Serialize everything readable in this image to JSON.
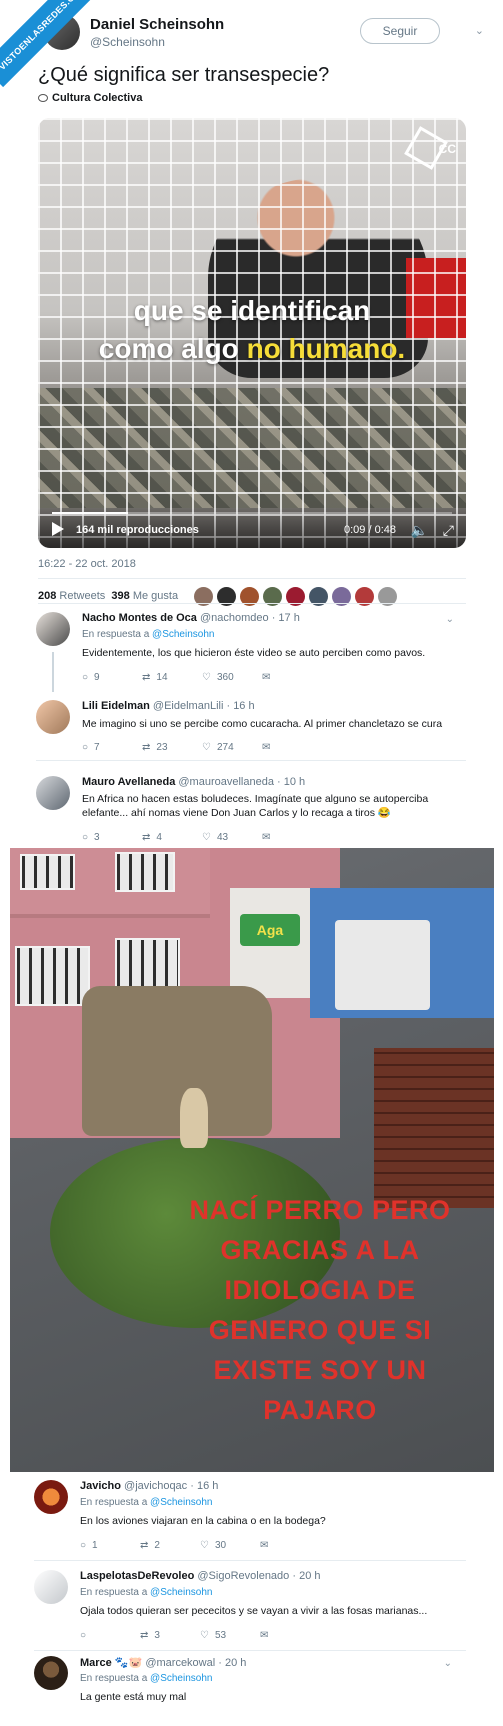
{
  "watermark": "VISTOENLASREDES.COM",
  "tweet": {
    "author_name": "Daniel Scheinsohn",
    "author_handle": "@Scheinsohn",
    "follow_label": "Seguir",
    "text": "¿Qué significa ser transespecie?",
    "source": "Cultura Colectiva",
    "video": {
      "caption_line1": "que se identifican",
      "caption_line2_plain": "como algo",
      "caption_line2_highlight": "no humano.",
      "brand": "CC",
      "views": "164 mil reproducciones",
      "timecode": "0:09 / 0:48",
      "progress_fraction": 0.19
    },
    "timestamp": "16:22 - 22 oct. 2018",
    "retweets_count": "208",
    "retweets_label": "Retweets",
    "likes_count": "398",
    "likes_label": "Me gusta"
  },
  "replies_top": [
    {
      "name": "Nacho Montes de Oca",
      "handle": "@nachomdeo",
      "time": "· 17 h",
      "in_reply_prefix": "En respuesta a",
      "in_reply_to": "@Scheinsohn",
      "text": "Evidentemente, los que hicieron éste video se auto perciben como pavos.",
      "replies": "9",
      "retweets": "14",
      "likes": "360"
    },
    {
      "name": "Lili Eidelman",
      "handle": "@EidelmanLili",
      "time": "· 16 h",
      "text": "Me imagino si uno se percibe como cucaracha. Al primer chancletazo se cura",
      "replies": "7",
      "retweets": "23",
      "likes": "274"
    },
    {
      "name": "Mauro Avellaneda",
      "handle": "@mauroavellaneda",
      "time": "· 10 h",
      "text": "En Africa no hacen estas boludeces. Imagínate que alguno se autoperciba elefante... ahí nomas viene Don Juan Carlos y lo recaga a tiros 😂",
      "replies": "3",
      "retweets": "4",
      "likes": "43"
    }
  ],
  "meme": {
    "text_lines": [
      "NACÍ PERRO PERO",
      "GRACIAS A LA",
      "IDIOLOGIA DE",
      "GENERO QUE SI",
      "EXISTE SOY UN",
      "PAJARO"
    ],
    "shop_sign": "Aga"
  },
  "replies_bottom": [
    {
      "name": "Javicho",
      "handle": "@javichoqac",
      "time": "· 16 h",
      "in_reply_prefix": "En respuesta a",
      "in_reply_to": "@Scheinsohn",
      "text": "En los aviones viajaran en la cabina o en la bodega?",
      "replies": "1",
      "retweets": "2",
      "likes": "30"
    },
    {
      "name": "LaspelotasDeRevoleo",
      "handle": "@SigoRevolenado",
      "time": "· 20 h",
      "in_reply_prefix": "En respuesta a",
      "in_reply_to": "@Scheinsohn",
      "text": "Ojala todos quieran ser pececitos y se vayan a vivir a las fosas marianas...",
      "replies": "",
      "retweets": "3",
      "likes": "53"
    },
    {
      "name": "Marce",
      "name_suffix": "🐾🐷",
      "handle": "@marcekowal",
      "time": "· 20 h",
      "in_reply_prefix": "En respuesta a",
      "in_reply_to": "@Scheinsohn",
      "text": "La gente está muy mal"
    }
  ],
  "colors": {
    "accent": "#1b95e0",
    "meme_text": "#e0322b",
    "caption_highlight": "#f6dd38"
  }
}
